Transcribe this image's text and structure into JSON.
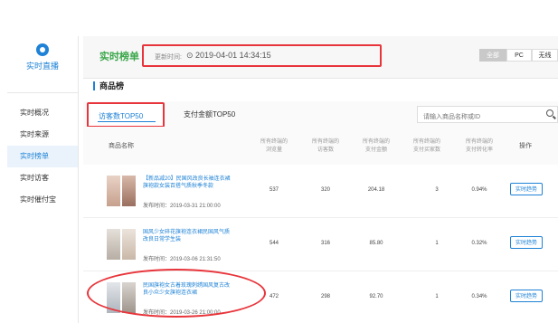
{
  "sidebar": {
    "title": "实时直播",
    "items": [
      {
        "label": "实时概况",
        "active": false
      },
      {
        "label": "实时来源",
        "active": false
      },
      {
        "label": "实时榜单",
        "active": true
      },
      {
        "label": "实时访客",
        "active": false
      },
      {
        "label": "实时催付宝",
        "active": false
      }
    ]
  },
  "header": {
    "title": "实时榜单",
    "time_label": "更新时间:",
    "time_value": "⊙ 2019-04-01 14:34:15",
    "segments": [
      {
        "label": "全部",
        "active": true
      },
      {
        "label": "PC",
        "active": false
      },
      {
        "label": "无线",
        "active": false
      }
    ]
  },
  "section_title": "商品榜",
  "tabs": [
    {
      "label": "访客数TOP50",
      "active": true
    },
    {
      "label": "支付金额TOP50",
      "active": false
    }
  ],
  "search": {
    "placeholder": "请输入商品名称或ID"
  },
  "table": {
    "col_product": "商品名称",
    "col_sub": "所有终端的",
    "columns": [
      "浏览量",
      "访客数",
      "支付金额",
      "支付买家数",
      "支付转化率"
    ],
    "col_action": "操作",
    "action_label": "实时趋势",
    "rows": [
      {
        "name": "【新品减20】民国风改良长袖连衣裙旗袍款女装百搭气质秋季冬款",
        "time": "发布时间：2019-03-31 21:00:00",
        "values": [
          "537",
          "320",
          "204.18",
          "3",
          "0.94%"
        ]
      },
      {
        "name": "国风少女碎花旗袍连衣裙民国风气质改良日常学生装",
        "time": "发布时间：2019-03-06 21:31:50",
        "values": [
          "544",
          "316",
          "85.80",
          "1",
          "0.32%"
        ]
      },
      {
        "name": "民国旗袍女古着玫瑰刺绣国风复古改良小众少女旗袍连衣裙",
        "time": "发布时间：2019-03-26 21:00:00",
        "values": [
          "472",
          "298",
          "92.70",
          "1",
          "0.34%"
        ]
      }
    ]
  },
  "colors": {
    "accent": "#1e82d6",
    "title_green": "#3aa64a",
    "highlight_red": "#e8353b"
  }
}
